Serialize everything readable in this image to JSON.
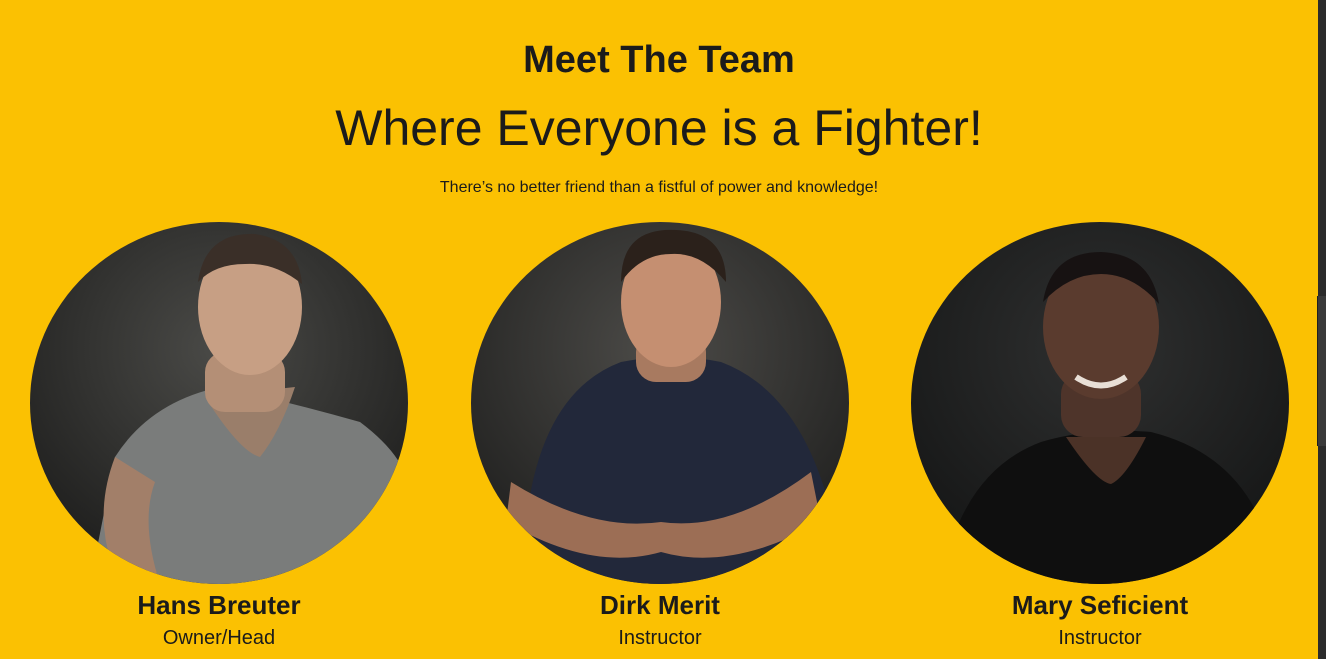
{
  "section": {
    "title": "Meet The Team",
    "headline": "Where Everyone is a Fighter!",
    "tagline": "There’s no better friend than a fistful of power and knowledge!"
  },
  "team": [
    {
      "name": "Hans Breuter",
      "role": "Owner/Head",
      "photo_icon": "portrait-photo"
    },
    {
      "name": "Dirk Merit",
      "role": "Instructor",
      "photo_icon": "portrait-photo"
    },
    {
      "name": "Mary Seficient",
      "role": "Instructor",
      "photo_icon": "portrait-photo"
    }
  ],
  "colors": {
    "background": "#fbc102",
    "text": "#1b1b1b",
    "photo_backdrop": "#2a2a2a"
  }
}
